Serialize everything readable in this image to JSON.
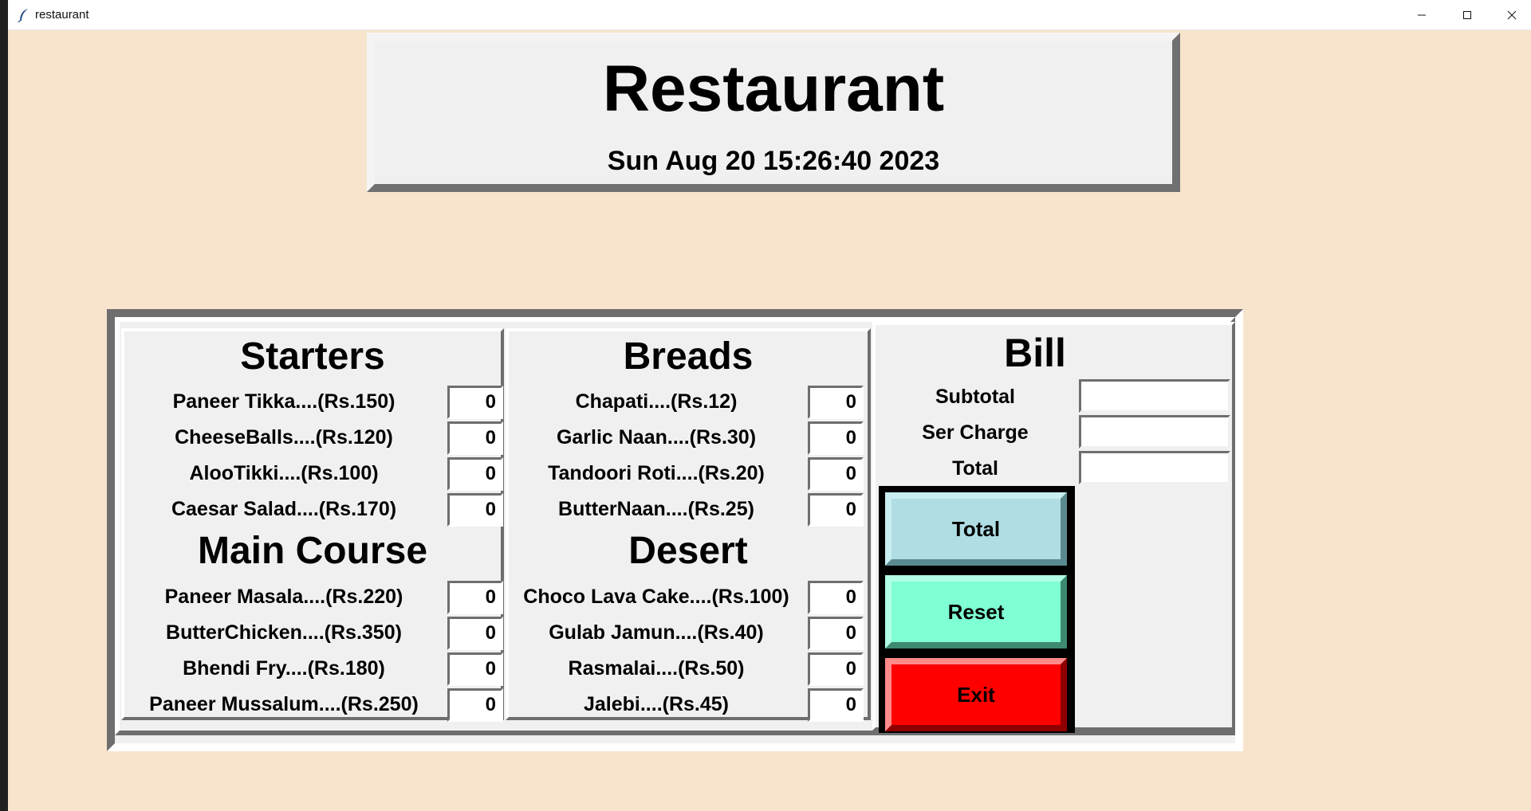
{
  "window": {
    "title": "restaurant",
    "icon": "feather-icon",
    "controls": [
      "minimize-icon",
      "maximize-icon",
      "close-icon"
    ]
  },
  "header": {
    "title": "Restaurant",
    "datetime": "Sun Aug 20 15:26:40 2023"
  },
  "starters": {
    "title": "Starters",
    "items": [
      {
        "label": "Paneer Tikka....(Rs.150)",
        "qty": "0"
      },
      {
        "label": "CheeseBalls....(Rs.120)",
        "qty": "0"
      },
      {
        "label": "AlooTikki....(Rs.100)",
        "qty": "0"
      },
      {
        "label": "Caesar Salad....(Rs.170)",
        "qty": "0"
      }
    ]
  },
  "main_course": {
    "title": "Main Course",
    "items": [
      {
        "label": "Paneer Masala....(Rs.220)",
        "qty": "0"
      },
      {
        "label": "ButterChicken....(Rs.350)",
        "qty": "0"
      },
      {
        "label": "Bhendi Fry....(Rs.180)",
        "qty": "0"
      },
      {
        "label": "Paneer Mussalum....(Rs.250)",
        "qty": "0"
      }
    ]
  },
  "breads": {
    "title": "Breads",
    "items": [
      {
        "label": "Chapati....(Rs.12)",
        "qty": "0"
      },
      {
        "label": "Garlic Naan....(Rs.30)",
        "qty": "0"
      },
      {
        "label": "Tandoori Roti....(Rs.20)",
        "qty": "0"
      },
      {
        "label": "ButterNaan....(Rs.25)",
        "qty": "0"
      }
    ]
  },
  "desert": {
    "title": "Desert",
    "items": [
      {
        "label": "Choco Lava Cake....(Rs.100)",
        "qty": "0"
      },
      {
        "label": "Gulab Jamun....(Rs.40)",
        "qty": "0"
      },
      {
        "label": "Rasmalai....(Rs.50)",
        "qty": "0"
      },
      {
        "label": "Jalebi....(Rs.45)",
        "qty": "0"
      }
    ]
  },
  "bill": {
    "title": "Bill",
    "subtotal_label": "Subtotal",
    "subtotal_value": "",
    "service_label": "Ser Charge",
    "service_value": "",
    "total_label": "Total",
    "total_value": "",
    "total_button": "Total",
    "reset_button": "Reset",
    "exit_button": "Exit"
  },
  "colors": {
    "background": "#f8e4cc",
    "panel": "#f0f0f0",
    "total_button": "#b0dde4",
    "reset_button": "#7fffd4",
    "exit_button": "#ff0000"
  }
}
